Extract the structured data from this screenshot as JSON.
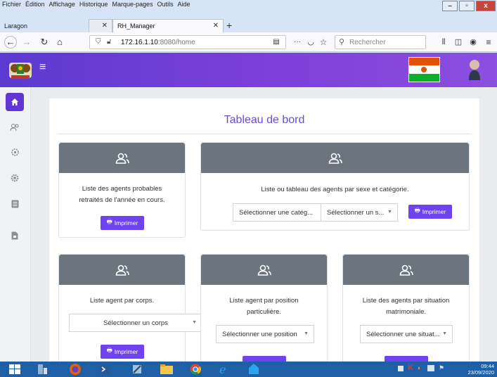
{
  "browser": {
    "menu": [
      "Fichier",
      "Édition",
      "Affichage",
      "Historique",
      "Marque-pages",
      "Outils",
      "Aide"
    ],
    "window_title": "Laragon",
    "tabs": [
      {
        "label": "",
        "active": false
      },
      {
        "label": "RH_Manager",
        "active": true
      }
    ],
    "new_tab": "+",
    "url_host": "172.16.1.10",
    "url_rest": ":8080/home",
    "search_placeholder": "Rechercher",
    "more": "···"
  },
  "header": {
    "menu_icon": "hamburger-icon",
    "flag_colors": {
      "orange": "#e05206",
      "white": "#ffffff",
      "green": "#0db02b"
    },
    "gradient": [
      "#5b3bd1",
      "#8d4fe0"
    ]
  },
  "sidebar": {
    "items": [
      "home-icon",
      "users-icon",
      "cogs-icon",
      "gear-icon",
      "list-icon",
      "file-icon"
    ]
  },
  "main": {
    "title": "Tableau de bord",
    "cards": [
      {
        "text": "Liste des agents probables retraités de l'année en cours.",
        "button": "Imprimer"
      },
      {
        "text": "Liste ou tableau des agents par sexe et catégorie.",
        "select1": "Sélectionner une catég...",
        "select2": "Sélectionner un s...",
        "button": "Imprimer"
      },
      {
        "text": "Liste agent par corps.",
        "select1": "Sélectionner un corps",
        "button": "Imprimer"
      },
      {
        "text": "Liste agent par position particulière.",
        "select1": "Sélectionner une position",
        "button": ""
      },
      {
        "text": "Liste des agents par situation matrimoniale.",
        "select1": "Sélectionner une situat...",
        "button": ""
      }
    ]
  },
  "taskbar": {
    "time": "09:44",
    "date": "23/09/2020"
  },
  "colors": {
    "accent": "#6f42f0",
    "card_header": "#6c757d",
    "title": "#6a4bd6",
    "taskbar": "#1f5fa6"
  }
}
